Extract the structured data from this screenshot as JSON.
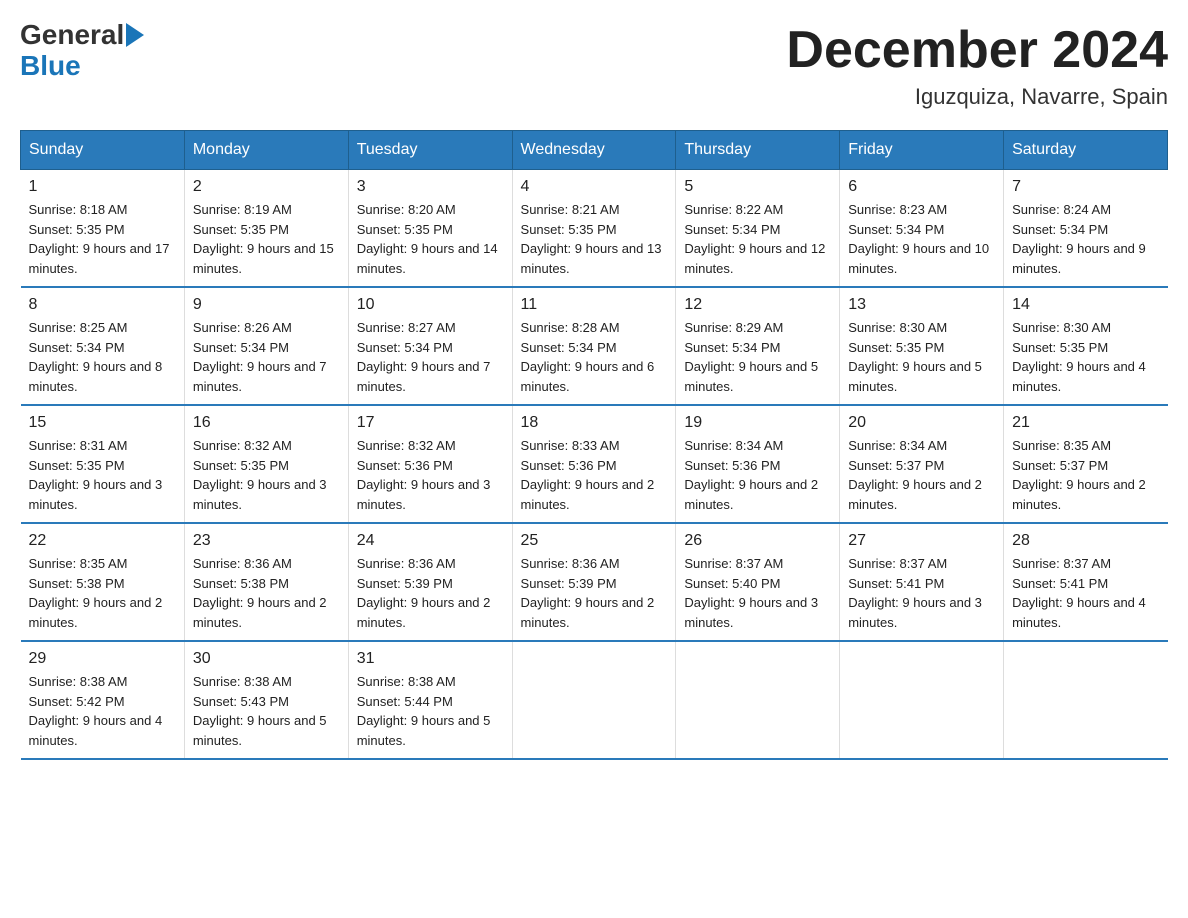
{
  "logo": {
    "general": "General",
    "blue": "Blue"
  },
  "title": "December 2024",
  "location": "Iguzquiza, Navarre, Spain",
  "days_of_week": [
    "Sunday",
    "Monday",
    "Tuesday",
    "Wednesday",
    "Thursday",
    "Friday",
    "Saturday"
  ],
  "weeks": [
    [
      {
        "day": "1",
        "sunrise": "8:18 AM",
        "sunset": "5:35 PM",
        "daylight": "9 hours and 17 minutes."
      },
      {
        "day": "2",
        "sunrise": "8:19 AM",
        "sunset": "5:35 PM",
        "daylight": "9 hours and 15 minutes."
      },
      {
        "day": "3",
        "sunrise": "8:20 AM",
        "sunset": "5:35 PM",
        "daylight": "9 hours and 14 minutes."
      },
      {
        "day": "4",
        "sunrise": "8:21 AM",
        "sunset": "5:35 PM",
        "daylight": "9 hours and 13 minutes."
      },
      {
        "day": "5",
        "sunrise": "8:22 AM",
        "sunset": "5:34 PM",
        "daylight": "9 hours and 12 minutes."
      },
      {
        "day": "6",
        "sunrise": "8:23 AM",
        "sunset": "5:34 PM",
        "daylight": "9 hours and 10 minutes."
      },
      {
        "day": "7",
        "sunrise": "8:24 AM",
        "sunset": "5:34 PM",
        "daylight": "9 hours and 9 minutes."
      }
    ],
    [
      {
        "day": "8",
        "sunrise": "8:25 AM",
        "sunset": "5:34 PM",
        "daylight": "9 hours and 8 minutes."
      },
      {
        "day": "9",
        "sunrise": "8:26 AM",
        "sunset": "5:34 PM",
        "daylight": "9 hours and 7 minutes."
      },
      {
        "day": "10",
        "sunrise": "8:27 AM",
        "sunset": "5:34 PM",
        "daylight": "9 hours and 7 minutes."
      },
      {
        "day": "11",
        "sunrise": "8:28 AM",
        "sunset": "5:34 PM",
        "daylight": "9 hours and 6 minutes."
      },
      {
        "day": "12",
        "sunrise": "8:29 AM",
        "sunset": "5:34 PM",
        "daylight": "9 hours and 5 minutes."
      },
      {
        "day": "13",
        "sunrise": "8:30 AM",
        "sunset": "5:35 PM",
        "daylight": "9 hours and 5 minutes."
      },
      {
        "day": "14",
        "sunrise": "8:30 AM",
        "sunset": "5:35 PM",
        "daylight": "9 hours and 4 minutes."
      }
    ],
    [
      {
        "day": "15",
        "sunrise": "8:31 AM",
        "sunset": "5:35 PM",
        "daylight": "9 hours and 3 minutes."
      },
      {
        "day": "16",
        "sunrise": "8:32 AM",
        "sunset": "5:35 PM",
        "daylight": "9 hours and 3 minutes."
      },
      {
        "day": "17",
        "sunrise": "8:32 AM",
        "sunset": "5:36 PM",
        "daylight": "9 hours and 3 minutes."
      },
      {
        "day": "18",
        "sunrise": "8:33 AM",
        "sunset": "5:36 PM",
        "daylight": "9 hours and 2 minutes."
      },
      {
        "day": "19",
        "sunrise": "8:34 AM",
        "sunset": "5:36 PM",
        "daylight": "9 hours and 2 minutes."
      },
      {
        "day": "20",
        "sunrise": "8:34 AM",
        "sunset": "5:37 PM",
        "daylight": "9 hours and 2 minutes."
      },
      {
        "day": "21",
        "sunrise": "8:35 AM",
        "sunset": "5:37 PM",
        "daylight": "9 hours and 2 minutes."
      }
    ],
    [
      {
        "day": "22",
        "sunrise": "8:35 AM",
        "sunset": "5:38 PM",
        "daylight": "9 hours and 2 minutes."
      },
      {
        "day": "23",
        "sunrise": "8:36 AM",
        "sunset": "5:38 PM",
        "daylight": "9 hours and 2 minutes."
      },
      {
        "day": "24",
        "sunrise": "8:36 AM",
        "sunset": "5:39 PM",
        "daylight": "9 hours and 2 minutes."
      },
      {
        "day": "25",
        "sunrise": "8:36 AM",
        "sunset": "5:39 PM",
        "daylight": "9 hours and 2 minutes."
      },
      {
        "day": "26",
        "sunrise": "8:37 AM",
        "sunset": "5:40 PM",
        "daylight": "9 hours and 3 minutes."
      },
      {
        "day": "27",
        "sunrise": "8:37 AM",
        "sunset": "5:41 PM",
        "daylight": "9 hours and 3 minutes."
      },
      {
        "day": "28",
        "sunrise": "8:37 AM",
        "sunset": "5:41 PM",
        "daylight": "9 hours and 4 minutes."
      }
    ],
    [
      {
        "day": "29",
        "sunrise": "8:38 AM",
        "sunset": "5:42 PM",
        "daylight": "9 hours and 4 minutes."
      },
      {
        "day": "30",
        "sunrise": "8:38 AM",
        "sunset": "5:43 PM",
        "daylight": "9 hours and 5 minutes."
      },
      {
        "day": "31",
        "sunrise": "8:38 AM",
        "sunset": "5:44 PM",
        "daylight": "9 hours and 5 minutes."
      },
      null,
      null,
      null,
      null
    ]
  ]
}
